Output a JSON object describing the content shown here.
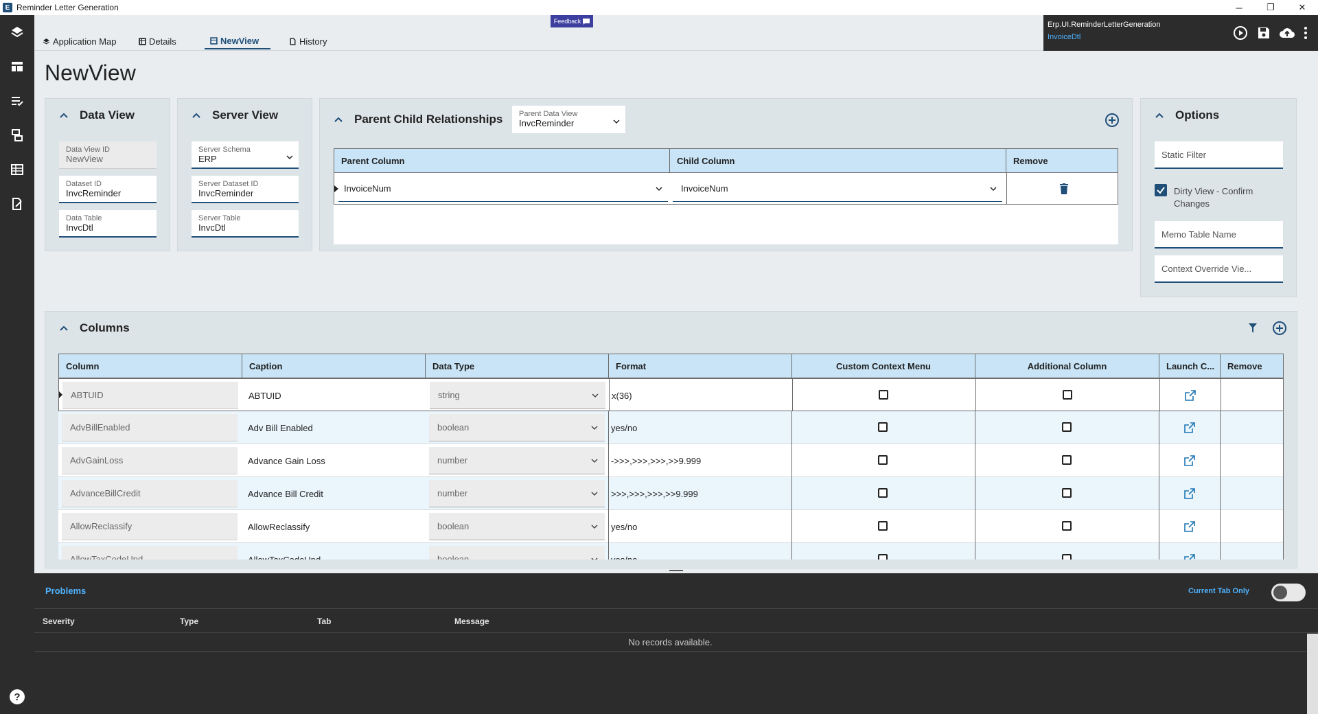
{
  "window": {
    "title": "Reminder Letter Generation",
    "minimize": "─",
    "restore": "❐",
    "close": "✕"
  },
  "nav": {
    "tabs": [
      {
        "label": "Application Map",
        "icon": "layers-icon"
      },
      {
        "label": "Details",
        "icon": "table-icon"
      },
      {
        "label": "NewView",
        "icon": "view-icon",
        "active": true
      },
      {
        "label": "History",
        "icon": "history-icon"
      }
    ],
    "feedback": "Feedback"
  },
  "header": {
    "app_id": "Erp.UI.ReminderLetterGeneration",
    "current_view": "InvoiceDtl"
  },
  "page": {
    "title": "NewView"
  },
  "data_view": {
    "title": "Data View",
    "fields": [
      {
        "label": "Data View ID",
        "value": "NewView",
        "readonly": true
      },
      {
        "label": "Dataset ID",
        "value": "InvcReminder"
      },
      {
        "label": "Data Table",
        "value": "InvcDtl"
      }
    ]
  },
  "server_view": {
    "title": "Server View",
    "fields": [
      {
        "label": "Server Schema",
        "value": "ERP"
      },
      {
        "label": "Server Dataset ID",
        "value": "InvcReminder"
      },
      {
        "label": "Server Table",
        "value": "InvcDtl"
      }
    ]
  },
  "parent_child": {
    "title": "Parent Child Relationships",
    "parent_data_view_label": "Parent Data View",
    "parent_data_view_value": "InvcReminder",
    "headers": [
      "Parent Column",
      "Child Column",
      "Remove"
    ],
    "rows": [
      {
        "parent": "InvoiceNum",
        "child": "InvoiceNum"
      }
    ]
  },
  "options": {
    "title": "Options",
    "static_filter_placeholder": "Static Filter",
    "dirty_view_label": "Dirty View - Confirm Changes",
    "dirty_view_checked": true,
    "memo_table_placeholder": "Memo Table Name",
    "context_override_placeholder": "Context Override Vie..."
  },
  "columns": {
    "title": "Columns",
    "headers": [
      "Column",
      "Caption",
      "Data Type",
      "Format",
      "Custom Context Menu",
      "Additional Column",
      "Launch C...",
      "Remove"
    ],
    "rows": [
      {
        "column": "ABTUID",
        "caption": "ABTUID",
        "type": "string",
        "format": "x(36)"
      },
      {
        "column": "AdvBillEnabled",
        "caption": "Adv Bill Enabled",
        "type": "boolean",
        "format": "yes/no"
      },
      {
        "column": "AdvGainLoss",
        "caption": "Advance Gain Loss",
        "type": "number",
        "format": "->>>,>>>,>>>,>>9.999"
      },
      {
        "column": "AdvanceBillCredit",
        "caption": "Advance Bill Credit",
        "type": "number",
        "format": ">>>,>>>,>>>,>>9.999"
      },
      {
        "column": "AllowReclassify",
        "caption": "AllowReclassify",
        "type": "boolean",
        "format": "yes/no"
      },
      {
        "column": "AllowTaxCodeUpd",
        "caption": "AllowTaxCodeUpd",
        "type": "boolean",
        "format": "yes/no"
      }
    ]
  },
  "problems": {
    "title": "Problems",
    "toggle_label": "Current Tab Only",
    "headers": [
      "Severity",
      "Type",
      "Tab",
      "Message"
    ],
    "empty_text": "No records available."
  }
}
